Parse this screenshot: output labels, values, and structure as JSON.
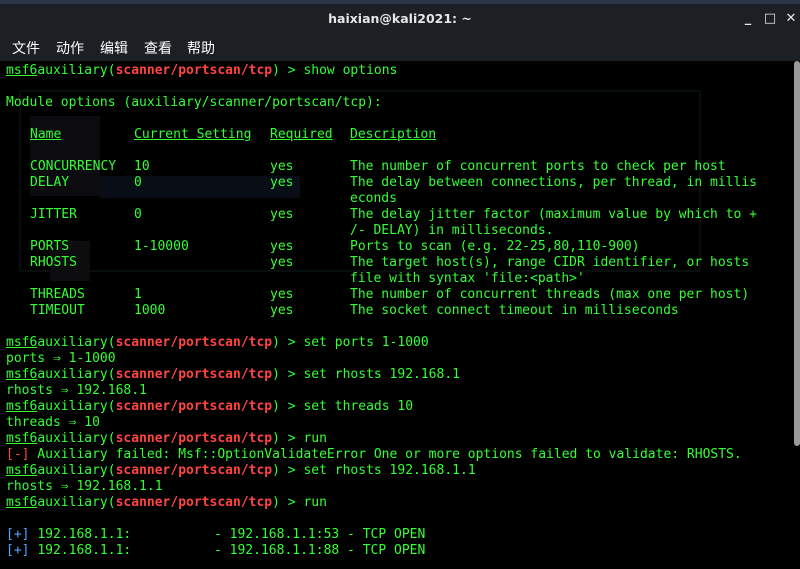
{
  "window": {
    "title": "haixian@kali2021: ~",
    "controls": {
      "minimize": "_",
      "maximize": "□",
      "close": "✕"
    }
  },
  "menu": [
    "文件",
    "动作",
    "编辑",
    "查看",
    "帮助"
  ],
  "prompt": {
    "msf": "msf6",
    "mod_prefix": "auxiliary(",
    "module": "scanner/portscan/tcp",
    "mod_suffix": ") > "
  },
  "commands": {
    "show_options": "show options",
    "set_ports": "set ports 1-1000",
    "set_rhosts_1": "set rhosts 192.168.1",
    "set_threads": "set threads 10",
    "run_1": "run",
    "set_rhosts_2": "set rhosts 192.168.1.1",
    "run_2": "run"
  },
  "outputs": {
    "module_options_heading": "Module options (auxiliary/scanner/portscan/tcp):",
    "ports_result": "ports ⇒ 1-1000",
    "rhosts_result_1": "rhosts ⇒ 192.168.1",
    "threads_result": "threads ⇒ 10",
    "error_tag": "[-]",
    "error_text": " Auxiliary failed: Msf::OptionValidateError One or more options failed to validate: RHOSTS.",
    "rhosts_result_2": "rhosts ⇒ 192.168.1.1"
  },
  "options_table": {
    "headers": [
      "Name",
      "Current Setting",
      "Required",
      "Description"
    ],
    "rows": [
      {
        "name": "CONCURRENCY",
        "setting": "10",
        "required": "yes",
        "desc": [
          "The number of concurrent ports to check per host"
        ]
      },
      {
        "name": "DELAY",
        "setting": "0",
        "required": "yes",
        "desc": [
          "The delay between connections, per thread, in millis",
          "econds"
        ]
      },
      {
        "name": "JITTER",
        "setting": "0",
        "required": "yes",
        "desc": [
          "The delay jitter factor (maximum value by which to +",
          "/- DELAY) in milliseconds."
        ]
      },
      {
        "name": "PORTS",
        "setting": "1-10000",
        "required": "yes",
        "desc": [
          "Ports to scan (e.g. 22-25,80,110-900)"
        ]
      },
      {
        "name": "RHOSTS",
        "setting": "",
        "required": "yes",
        "desc": [
          "The target host(s), range CIDR identifier, or hosts",
          "file with syntax 'file:<path>'"
        ]
      },
      {
        "name": "THREADS",
        "setting": "1",
        "required": "yes",
        "desc": [
          "The number of concurrent threads (max one per host)"
        ]
      },
      {
        "name": "TIMEOUT",
        "setting": "1000",
        "required": "yes",
        "desc": [
          "The socket connect timeout in milliseconds"
        ]
      }
    ]
  },
  "scan_results": [
    {
      "tag": "[+]",
      "host": "192.168.1.1:",
      "result": "- 192.168.1.1:53 - TCP OPEN"
    },
    {
      "tag": "[+]",
      "host": "192.168.1.1:",
      "result": "- 192.168.1.1:88 - TCP OPEN"
    }
  ],
  "colors": {
    "terminal_bg": "#000000",
    "text_green": "#33ff33",
    "module_red": "#ff4444",
    "success_blue": "#4da6ff",
    "titlebar": "#1c1f24"
  }
}
